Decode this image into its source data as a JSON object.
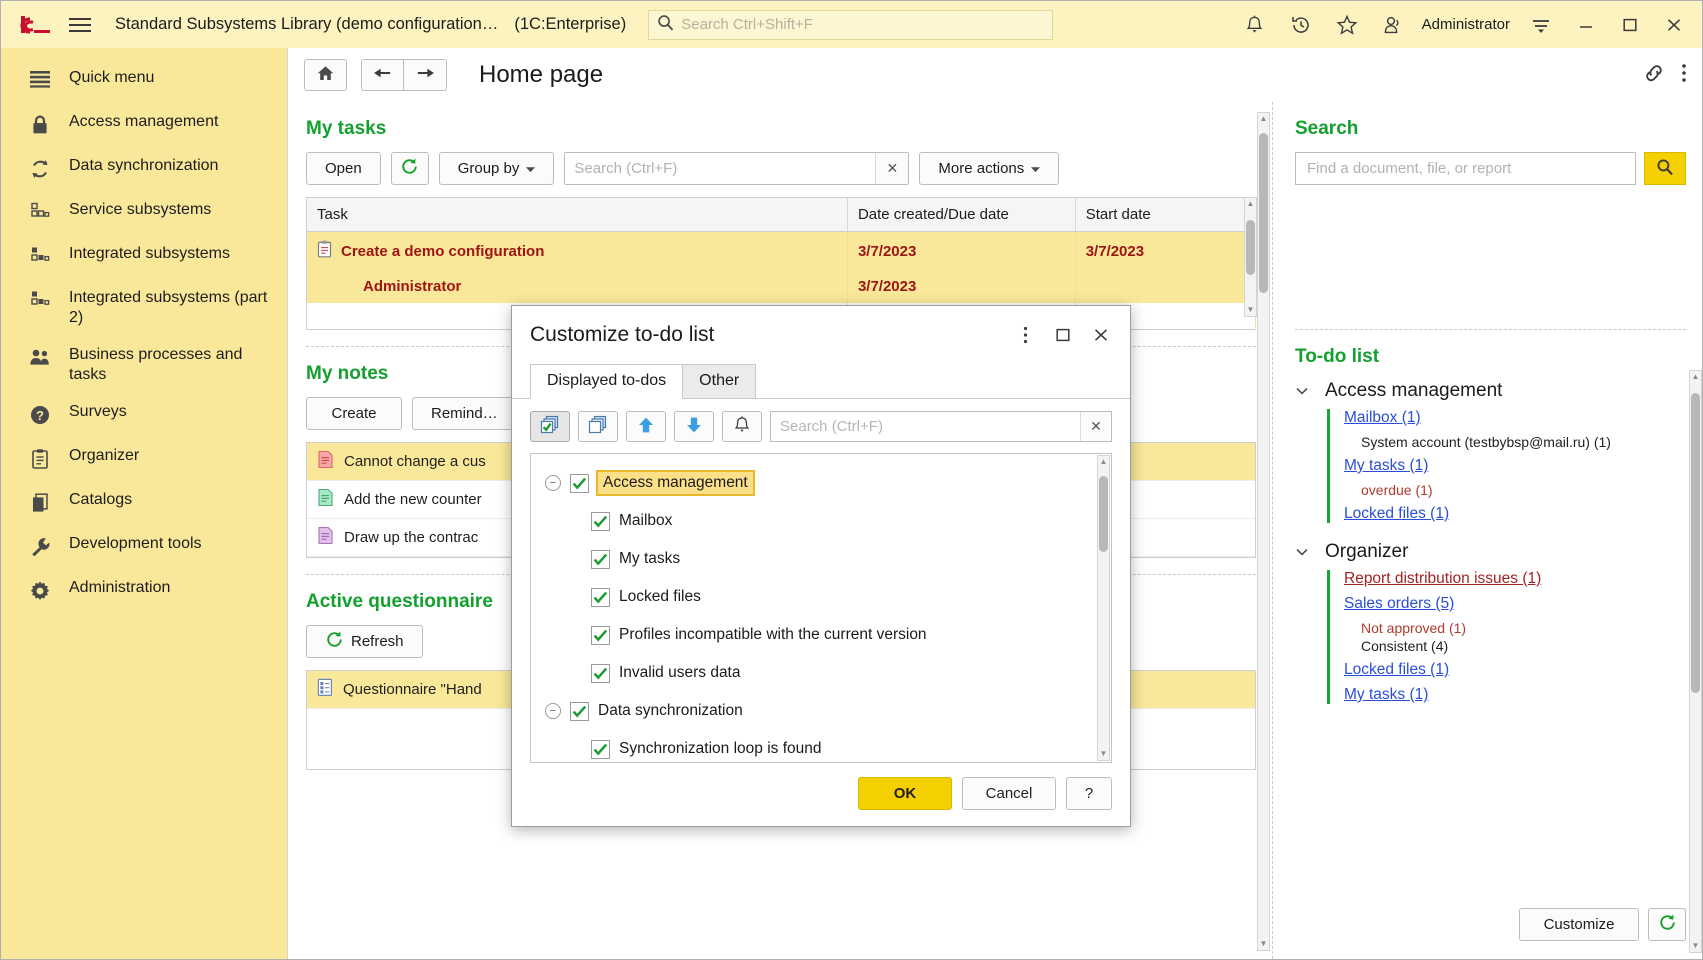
{
  "titlebar": {
    "logo": "1c-logo-icon",
    "menu_icon": "hamburger-menu-icon",
    "app_title": "Standard Subsystems Library (demo configuration…",
    "enterprise": "(1C:Enterprise)",
    "search_placeholder": "Search Ctrl+Shift+F",
    "search_value": "",
    "user": "Administrator",
    "icons": [
      "bell-icon",
      "history-icon",
      "star-icon",
      "users-icon",
      "options-menu-icon"
    ],
    "window_buttons": [
      "minimize-icon",
      "maximize-icon",
      "close-icon"
    ]
  },
  "sidebar": {
    "items": [
      {
        "label": "Quick menu",
        "icon": "list-icon"
      },
      {
        "label": "Access management",
        "icon": "lock-icon"
      },
      {
        "label": "Data synchronization",
        "icon": "sync-icon"
      },
      {
        "label": "Service subsystems",
        "icon": "blocks-outline-icon"
      },
      {
        "label": "Integrated subsystems",
        "icon": "blocks-half-icon"
      },
      {
        "label": "Integrated subsystems (part 2)",
        "icon": "blocks-half2-icon"
      },
      {
        "label": "Business processes and tasks",
        "icon": "people-icon"
      },
      {
        "label": "Surveys",
        "icon": "question-circle-icon"
      },
      {
        "label": "Organizer",
        "icon": "clipboard-icon"
      },
      {
        "label": "Catalogs",
        "icon": "copy-stack-icon"
      },
      {
        "label": "Development tools",
        "icon": "wrench-icon"
      },
      {
        "label": "Administration",
        "icon": "gear-icon"
      }
    ]
  },
  "navbar": {
    "home_icon": "home-icon",
    "back_icon": "arrow-left-icon",
    "forward_icon": "arrow-right-icon",
    "page_title": "Home page",
    "link_icon": "link-icon",
    "more_icon": "kebab-menu-icon"
  },
  "my_tasks": {
    "title": "My tasks",
    "buttons": {
      "open": "Open",
      "refresh_icon": "refresh-icon",
      "group_by": "Group by",
      "more_actions": "More actions"
    },
    "search_placeholder": "Search (Ctrl+F)",
    "search_value": "",
    "clear_icon": "clear-x-icon",
    "columns": [
      "Task",
      "Date created/Due date",
      "Start date"
    ],
    "rows": [
      {
        "icon": "clipboard-task-icon",
        "task": "Create a demo configuration",
        "date_created": "3/7/2023",
        "start_date": "3/7/2023",
        "indent": 0
      },
      {
        "icon": "",
        "task": "Administrator",
        "date_created": "3/7/2023",
        "start_date": "",
        "indent": 1
      }
    ]
  },
  "my_notes": {
    "title": "My notes",
    "buttons": {
      "create": "Create",
      "remind": "Remind…"
    },
    "rows": [
      {
        "icon": "note-red-icon",
        "text": "Cannot change a cus",
        "highlight": true
      },
      {
        "icon": "note-green-icon",
        "text": "Add the new counter",
        "highlight": false
      },
      {
        "icon": "note-purple-icon",
        "text": "Draw up the contrac",
        "highlight": false
      }
    ]
  },
  "active_questionnaires": {
    "title": "Active questionnaire",
    "refresh_label": "Refresh",
    "refresh_icon": "refresh-icon",
    "rows": [
      {
        "icon": "questionnaire-icon",
        "text": "Questionnaire \"Hand"
      }
    ]
  },
  "right_panel": {
    "search": {
      "title": "Search",
      "placeholder": "Find a document, file, or report",
      "value": "",
      "button_icon": "search-icon"
    },
    "todo": {
      "title": "To-do list",
      "groups": [
        {
          "name": "Access management",
          "chevron": "chevron-down-icon",
          "items": [
            {
              "label": "Mailbox (1)",
              "red": false,
              "subs": [
                {
                  "text": "System account (testbybsp@mail.ru) (1)",
                  "red": false
                }
              ]
            },
            {
              "label": "My tasks (1)",
              "red": false,
              "subs": [
                {
                  "text": "overdue (1)",
                  "red": true
                }
              ]
            },
            {
              "label": "Locked files (1)",
              "red": false,
              "subs": []
            }
          ]
        },
        {
          "name": "Organizer",
          "chevron": "chevron-down-icon",
          "items": [
            {
              "label": "Report distribution issues (1)",
              "red": true,
              "subs": []
            },
            {
              "label": "Sales orders (5)",
              "red": false,
              "subs": [
                {
                  "text": "Not approved (1)",
                  "red": true
                },
                {
                  "text": "Consistent (4)",
                  "red": false
                }
              ]
            },
            {
              "label": "Locked files (1)",
              "red": false,
              "subs": []
            },
            {
              "label": "My tasks (1)",
              "red": false,
              "subs": []
            }
          ]
        }
      ],
      "customize_label": "Customize",
      "refresh_icon": "refresh-icon"
    }
  },
  "dialog": {
    "title": "Customize to-do list",
    "header_icons": {
      "more": "kebab-menu-icon",
      "maximize": "maximize-icon",
      "close": "close-icon"
    },
    "tabs": [
      {
        "label": "Displayed to-dos",
        "active": true
      },
      {
        "label": "Other",
        "active": false
      }
    ],
    "toolbar": [
      {
        "icon": "check-all-stack-icon",
        "pressed": true
      },
      {
        "icon": "stack-icon",
        "pressed": false
      },
      {
        "icon": "arrow-up-blue-icon",
        "pressed": false
      },
      {
        "icon": "arrow-down-blue-icon",
        "pressed": false
      },
      {
        "icon": "bell-outline-icon",
        "pressed": false
      }
    ],
    "search_placeholder": "Search (Ctrl+F)",
    "search_value": "",
    "clear_icon": "clear-x-icon",
    "tree": [
      {
        "label": "Access management",
        "checked": true,
        "level": 0,
        "expandable": true,
        "selected": true
      },
      {
        "label": "Mailbox",
        "checked": true,
        "level": 1,
        "expandable": false,
        "selected": false
      },
      {
        "label": "My tasks",
        "checked": true,
        "level": 1,
        "expandable": false,
        "selected": false
      },
      {
        "label": "Locked files",
        "checked": true,
        "level": 1,
        "expandable": false,
        "selected": false
      },
      {
        "label": "Profiles incompatible with the current version",
        "checked": true,
        "level": 1,
        "expandable": false,
        "selected": false
      },
      {
        "label": "Invalid users data",
        "checked": true,
        "level": 1,
        "expandable": false,
        "selected": false
      },
      {
        "label": "Data synchronization",
        "checked": true,
        "level": 0,
        "expandable": true,
        "selected": false
      },
      {
        "label": "Synchronization loop is found",
        "checked": true,
        "level": 1,
        "expandable": false,
        "selected": false
      }
    ],
    "buttons": {
      "ok": "OK",
      "cancel": "Cancel",
      "help": "?"
    }
  },
  "colors": {
    "accent_yellow": "#fae89a",
    "title_yellow": "#fdf3c0",
    "green": "#14a02e",
    "link_blue": "#2a4fd6",
    "red": "#9e1414",
    "ok_yellow": "#f5d000"
  }
}
